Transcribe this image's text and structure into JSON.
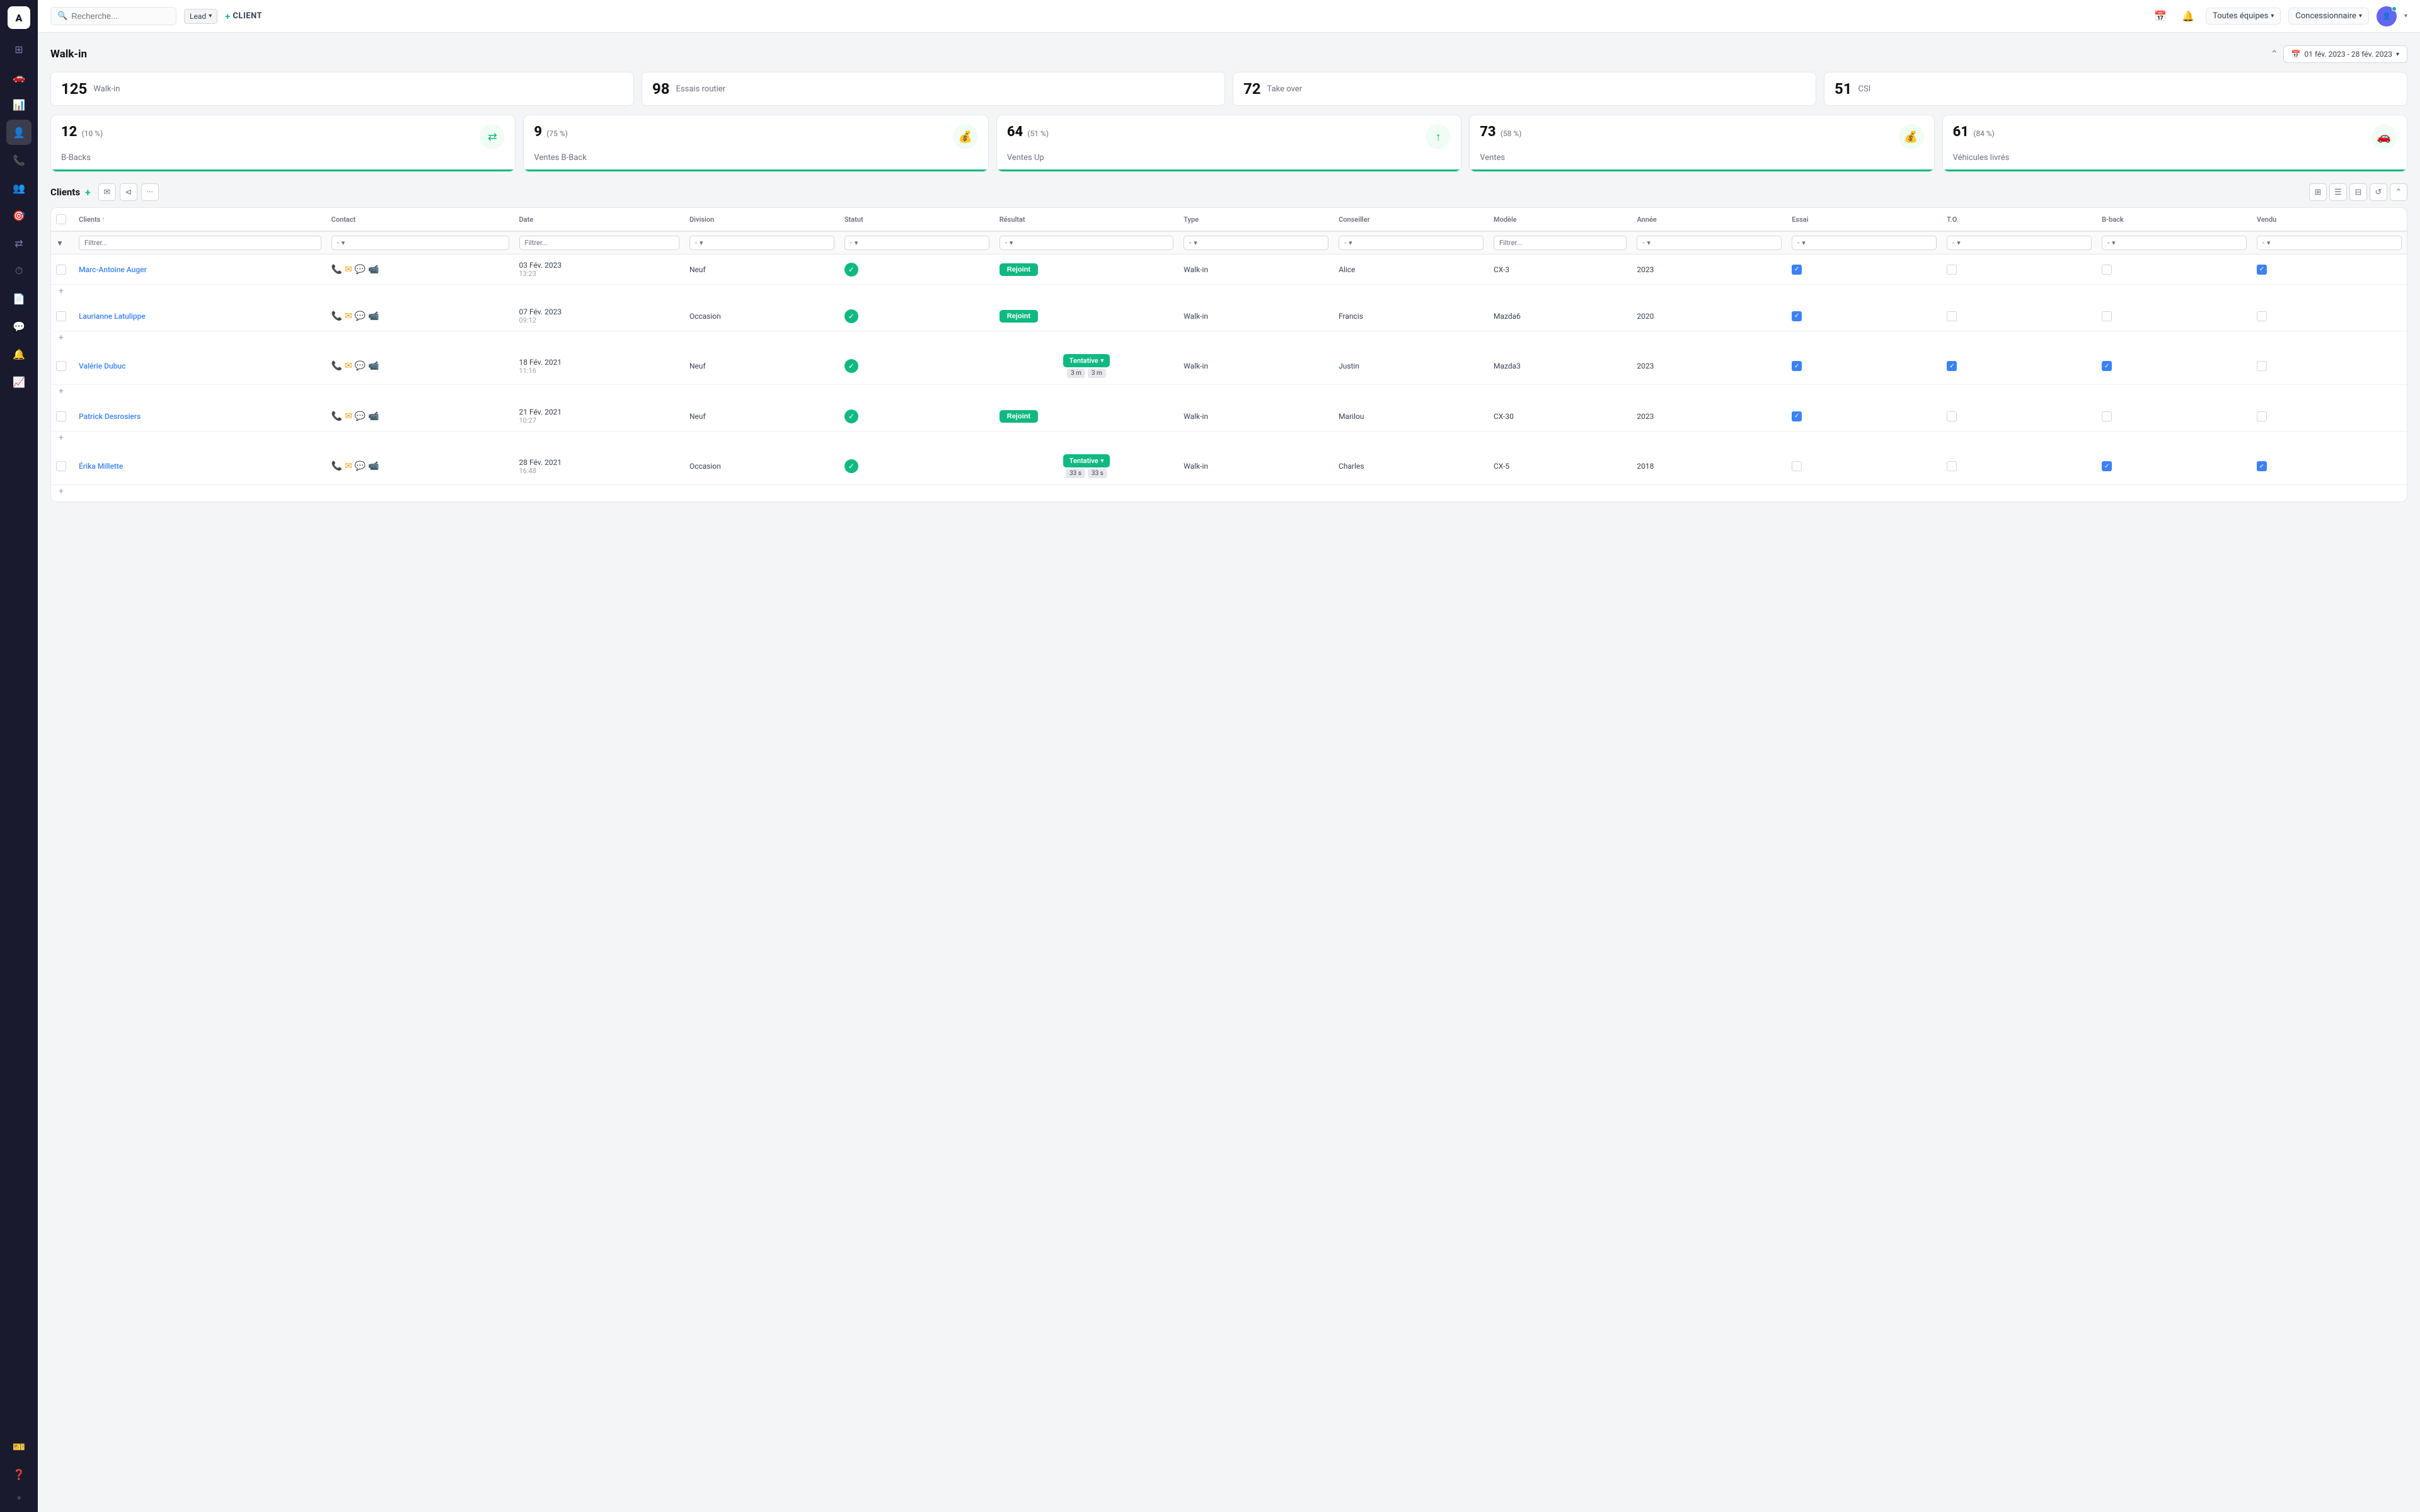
{
  "sidebar": {
    "logo": "A",
    "items": [
      {
        "id": "dashboard",
        "icon": "⊞",
        "active": false
      },
      {
        "id": "car",
        "icon": "🚗",
        "active": false
      },
      {
        "id": "chart",
        "icon": "📊",
        "active": false
      },
      {
        "id": "person",
        "icon": "👤",
        "active": true
      },
      {
        "id": "phone",
        "icon": "📞",
        "active": false
      },
      {
        "id": "group",
        "icon": "👥",
        "active": false
      },
      {
        "id": "target",
        "icon": "🎯",
        "active": false
      },
      {
        "id": "shuffle",
        "icon": "⇄",
        "active": false
      },
      {
        "id": "clock",
        "icon": "⏱",
        "active": false
      },
      {
        "id": "doc",
        "icon": "📄",
        "active": false
      },
      {
        "id": "chat",
        "icon": "💬",
        "active": false
      },
      {
        "id": "bell",
        "icon": "🔔",
        "active": false
      },
      {
        "id": "chart2",
        "icon": "📈",
        "active": false
      }
    ],
    "bottom_items": [
      {
        "id": "ticket",
        "icon": "🎫"
      },
      {
        "id": "help",
        "icon": "❓"
      }
    ],
    "expand": "»"
  },
  "topbar": {
    "search_placeholder": "Recherche...",
    "lead_label": "Lead",
    "client_label": "CLIENT",
    "teams_label": "Toutes équipes",
    "dealer_label": "Concessionnaire"
  },
  "walkin": {
    "title": "Walk-in",
    "date_range": "01 fév. 2023 - 28 fév. 2023",
    "stats": [
      {
        "num": "125",
        "label": "Walk-in"
      },
      {
        "num": "98",
        "label": "Essais routier"
      },
      {
        "num": "72",
        "label": "Take over"
      },
      {
        "num": "51",
        "label": "CSI"
      }
    ],
    "metrics": [
      {
        "num": "12",
        "pct": "(10 %)",
        "label": "B-Backs",
        "icon": "⇄"
      },
      {
        "num": "9",
        "pct": "(75 %)",
        "label": "Ventes B-Back",
        "icon": "💰"
      },
      {
        "num": "64",
        "pct": "(51 %)",
        "label": "Ventes Up",
        "icon": "↑"
      },
      {
        "num": "73",
        "pct": "(58 %)",
        "label": "Ventes",
        "icon": "💰"
      },
      {
        "num": "61",
        "pct": "(84 %)",
        "label": "Véhicules livrés",
        "icon": "🚗"
      }
    ]
  },
  "clients_section": {
    "title": "Clients",
    "table_headers": [
      "Clients",
      "Contact",
      "Date",
      "Division",
      "Statut",
      "Résultat",
      "Type",
      "Conseiller",
      "Modèle",
      "Année",
      "Essai",
      "T.O.",
      "B-back",
      "Vendu"
    ],
    "filter_row": {
      "clients": "Filtrer...",
      "contact": "-",
      "date": "Filtrer...",
      "division": "-",
      "statut": "-",
      "resultat": "-",
      "type": "-",
      "conseiller": "-",
      "modele": "Filtrer...",
      "annee": "-",
      "essai": "-",
      "to": "-",
      "bback": "-",
      "vendu": "-"
    },
    "rows": [
      {
        "id": "row1",
        "client": "Marc-Antoine Auger",
        "date": "03 Fév. 2023",
        "time": "13:23",
        "division": "Neuf",
        "statut": "check",
        "resultat": "Rejoint",
        "resultat_type": "rejoint",
        "type": "Walk-in",
        "conseiller": "Alice",
        "modele": "CX-3",
        "annee": "2023",
        "essai": true,
        "to": false,
        "bback": false,
        "vendu": true
      },
      {
        "id": "row2",
        "client": "Laurianne Latulippe",
        "date": "07 Fév. 2023",
        "time": "09:12",
        "division": "Occasion",
        "statut": "check",
        "resultat": "Rejoint",
        "resultat_type": "rejoint",
        "type": "Walk-in",
        "conseiller": "Francis",
        "modele": "Mazda6",
        "annee": "2020",
        "essai": true,
        "to": false,
        "bback": false,
        "vendu": false
      },
      {
        "id": "row3",
        "client": "Valérie Dubuc",
        "date": "18 Fév. 2021",
        "time": "11:16",
        "division": "Neuf",
        "statut": "check",
        "resultat": "Tentative",
        "resultat_type": "tentative",
        "tentative_times": [
          "3 m",
          "3 m"
        ],
        "type": "Walk-in",
        "conseiller": "Justin",
        "modele": "Mazda3",
        "annee": "2023",
        "essai": true,
        "to": true,
        "bback": true,
        "vendu": false
      },
      {
        "id": "row4",
        "client": "Patrick Desrosiers",
        "date": "21 Fév. 2021",
        "time": "10:27",
        "division": "Neuf",
        "statut": "check",
        "resultat": "Rejoint",
        "resultat_type": "rejoint",
        "type": "Walk-in",
        "conseiller": "Marilou",
        "modele": "CX-30",
        "annee": "2023",
        "essai": true,
        "to": false,
        "bback": false,
        "vendu": false
      },
      {
        "id": "row5",
        "client": "Érika Millette",
        "date": "28 Fév. 2021",
        "time": "16:48",
        "division": "Occasion",
        "statut": "check",
        "resultat": "Tentative",
        "resultat_type": "tentative",
        "tentative_times": [
          "33 s",
          "33 s"
        ],
        "type": "Walk-in",
        "conseiller": "Charles",
        "modele": "CX-5",
        "annee": "2018",
        "essai": false,
        "to": false,
        "bback": true,
        "vendu": true
      }
    ]
  }
}
